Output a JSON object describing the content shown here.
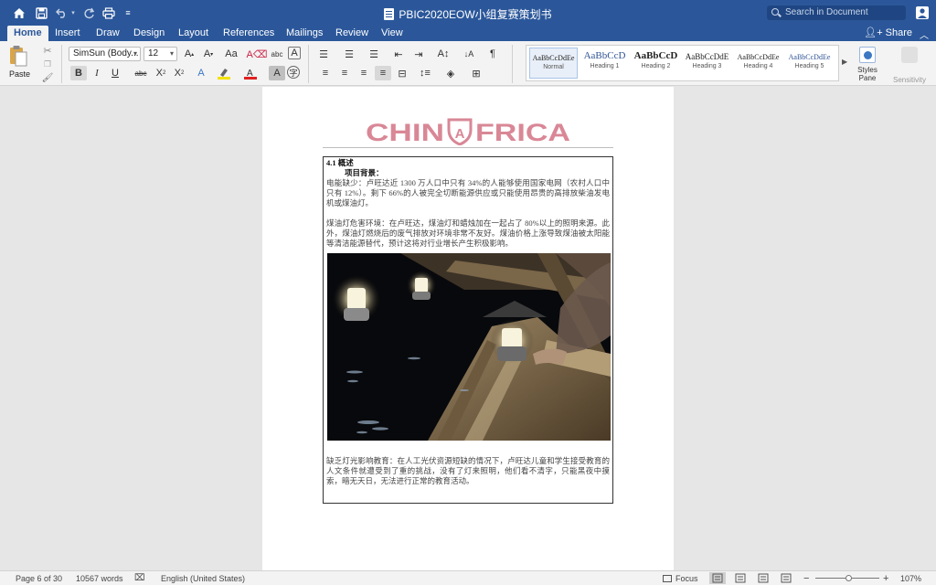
{
  "titlebar": {
    "doc_title": "PBIC2020EOW小组复赛策划书",
    "search_placeholder": "Search in Document",
    "quick_access": [
      "home-icon",
      "save-icon",
      "undo-icon",
      "redo-icon",
      "print-icon",
      "customize-icon"
    ]
  },
  "tabs": [
    "Home",
    "Insert",
    "Draw",
    "Design",
    "Layout",
    "References",
    "Mailings",
    "Review",
    "View"
  ],
  "active_tab": "Home",
  "share_label": "Share",
  "ribbon": {
    "paste_label": "Paste",
    "font_name": "SimSun (Body...",
    "font_size": "12",
    "styles": [
      {
        "sample": "AaBbCcDdEe",
        "name": "Normal"
      },
      {
        "sample": "AaBbCcD",
        "name": "Heading 1"
      },
      {
        "sample": "AaBbCcD",
        "name": "Heading 2"
      },
      {
        "sample": "AaBbCcDdE",
        "name": "Heading 3"
      },
      {
        "sample": "AaBbCcDdEe",
        "name": "Heading 4"
      },
      {
        "sample": "AaBbCcDdEe",
        "name": "Heading 5"
      }
    ],
    "styles_pane_label": "Styles Pane",
    "sensitivity_label": "Sensitivity",
    "accent_color": "#2b579a",
    "highlight_color": "#f5e200",
    "font_color": "#e02020"
  },
  "document": {
    "logo_left": "CHIN",
    "logo_right": "FRICA",
    "logo_emblem": "A",
    "logo_color": "#d98796",
    "section_title": "4.1 概述",
    "subheading": "项目背景：",
    "para1": "电能缺少：卢旺达近 1300 万人口中只有 34%的人能够使用国家电网（农村人口中只有 12%）。剩下 66%的人被完全切断能源供应或只能使用昂贵的高排放柴油发电机或煤油灯。",
    "para2": "煤油灯危害环境：在卢旺达，煤油灯和蜡烛加在一起占了 80%以上的照明来源。此外，煤油灯燃烧后的废气排放对环境非常不友好。煤油价格上涨导致煤油被太阳能等清洁能源替代，预计这将对行业增长产生积极影响。",
    "para3": "缺乏灯光影响教育：在人工光伏资源短缺的情况下，卢旺达儿童和学生接受教育的人文条件就遭受到了重的挑战，没有了灯来照明，他们看不清字，只能黑夜中摸索，暗无天日，无法进行正常的教育活动。"
  },
  "statusbar": {
    "page_info": "Page 6 of 30",
    "word_count": "10567 words",
    "language": "English (United States)",
    "focus_label": "Focus",
    "zoom": "107%"
  }
}
